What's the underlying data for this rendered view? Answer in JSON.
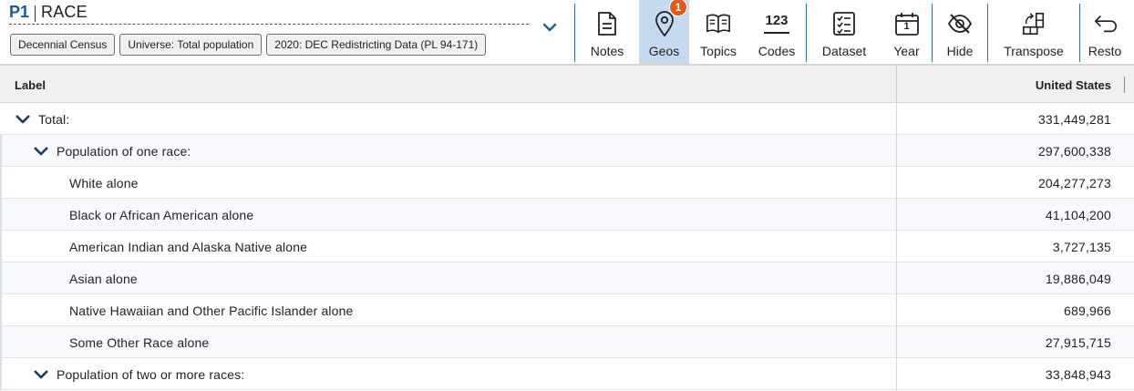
{
  "header": {
    "table_id": "P1",
    "table_title": "RACE",
    "chips": [
      "Decennial Census",
      "Universe: Total population",
      "2020: DEC Redistricting Data (PL 94-171)"
    ]
  },
  "toolbar": {
    "notes": "Notes",
    "geos": "Geos",
    "geos_badge": "1",
    "topics": "Topics",
    "codes": "Codes",
    "codes_icon_text": "123",
    "dataset": "Dataset",
    "year": "Year",
    "year_icon_text": "1",
    "hide": "Hide",
    "transpose": "Transpose",
    "restore": "Resto"
  },
  "table": {
    "col_label": "Label",
    "col_geo": "United States",
    "rows": [
      {
        "label": "Total:",
        "value": "331,449,281"
      },
      {
        "label": "Population of one race:",
        "value": "297,600,338"
      },
      {
        "label": "White alone",
        "value": "204,277,273"
      },
      {
        "label": "Black or African American alone",
        "value": "41,104,200"
      },
      {
        "label": "American Indian and Alaska Native alone",
        "value": "3,727,135"
      },
      {
        "label": "Asian alone",
        "value": "19,886,049"
      },
      {
        "label": "Native Hawaiian and Other Pacific Islander alone",
        "value": "689,966"
      },
      {
        "label": "Some Other Race alone",
        "value": "27,915,715"
      },
      {
        "label": "Population of two or more races:",
        "value": "33,848,943"
      }
    ]
  },
  "colors": {
    "accent": "#1a5aa6",
    "active_tool_bg": "#c5d9f1",
    "badge": "#e2591b"
  }
}
